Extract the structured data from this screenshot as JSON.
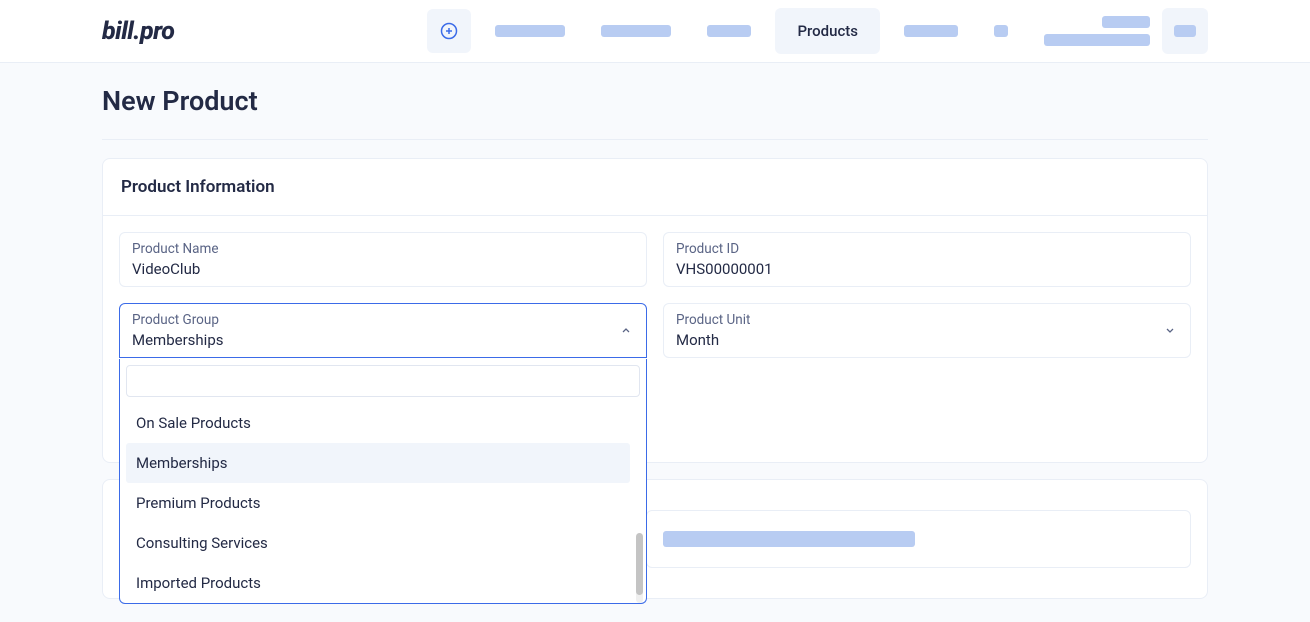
{
  "brand": "bill.pro",
  "nav": {
    "active_tab_label": "Products"
  },
  "page": {
    "title": "New Product"
  },
  "card1": {
    "title": "Product Information",
    "product_name": {
      "label": "Product Name",
      "value": "VideoClub"
    },
    "product_id": {
      "label": "Product ID",
      "value": "VHS00000001"
    },
    "product_group": {
      "label": "Product Group",
      "value": "Memberships",
      "options": [
        "On Sale Products",
        "Memberships",
        "Premium Products",
        "Consulting Services",
        "Imported Products"
      ]
    },
    "product_unit": {
      "label": "Product Unit",
      "value": "Month"
    }
  }
}
